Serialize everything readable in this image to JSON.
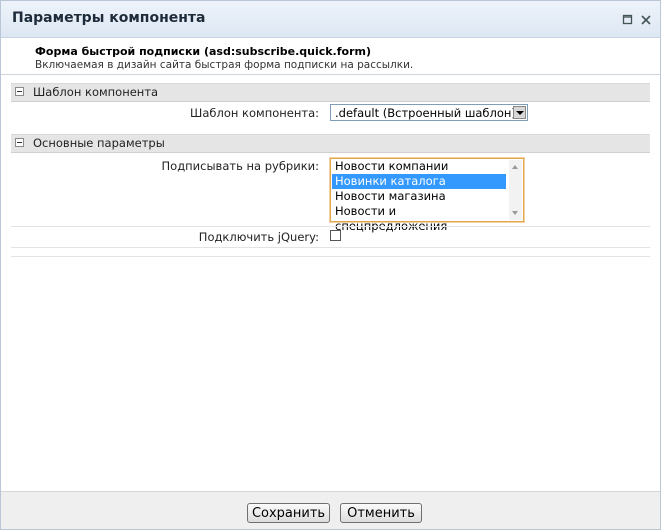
{
  "window": {
    "title": "Параметры компонента"
  },
  "component": {
    "name": "Форма быстрой подписки (asd:subscribe.quick.form)",
    "description": "Включаемая в дизайн сайта быстрая форма подписки на рассылки."
  },
  "sections": {
    "template": {
      "title": "Шаблон компонента",
      "field_label": "Шаблон компонента:",
      "selected": ".default (Встроенный шаблон)"
    },
    "basic": {
      "title": "Основные параметры",
      "rubrics_label": "Подписывать на рубрики:",
      "rubrics": [
        {
          "label": "Новости компании",
          "selected": false
        },
        {
          "label": "Новинки каталога",
          "selected": true
        },
        {
          "label": "Новости магазина",
          "selected": false
        },
        {
          "label": "Новости и спецпредложения",
          "selected": false
        }
      ],
      "jquery_label": "Подключить jQuery:",
      "jquery_checked": false
    }
  },
  "footer": {
    "save": "Сохранить",
    "cancel": "Отменить"
  },
  "icons": {
    "maximize": "maximize-icon",
    "close": "close-icon",
    "collapse": "minus-icon",
    "dropdown": "chevron-down-icon"
  }
}
